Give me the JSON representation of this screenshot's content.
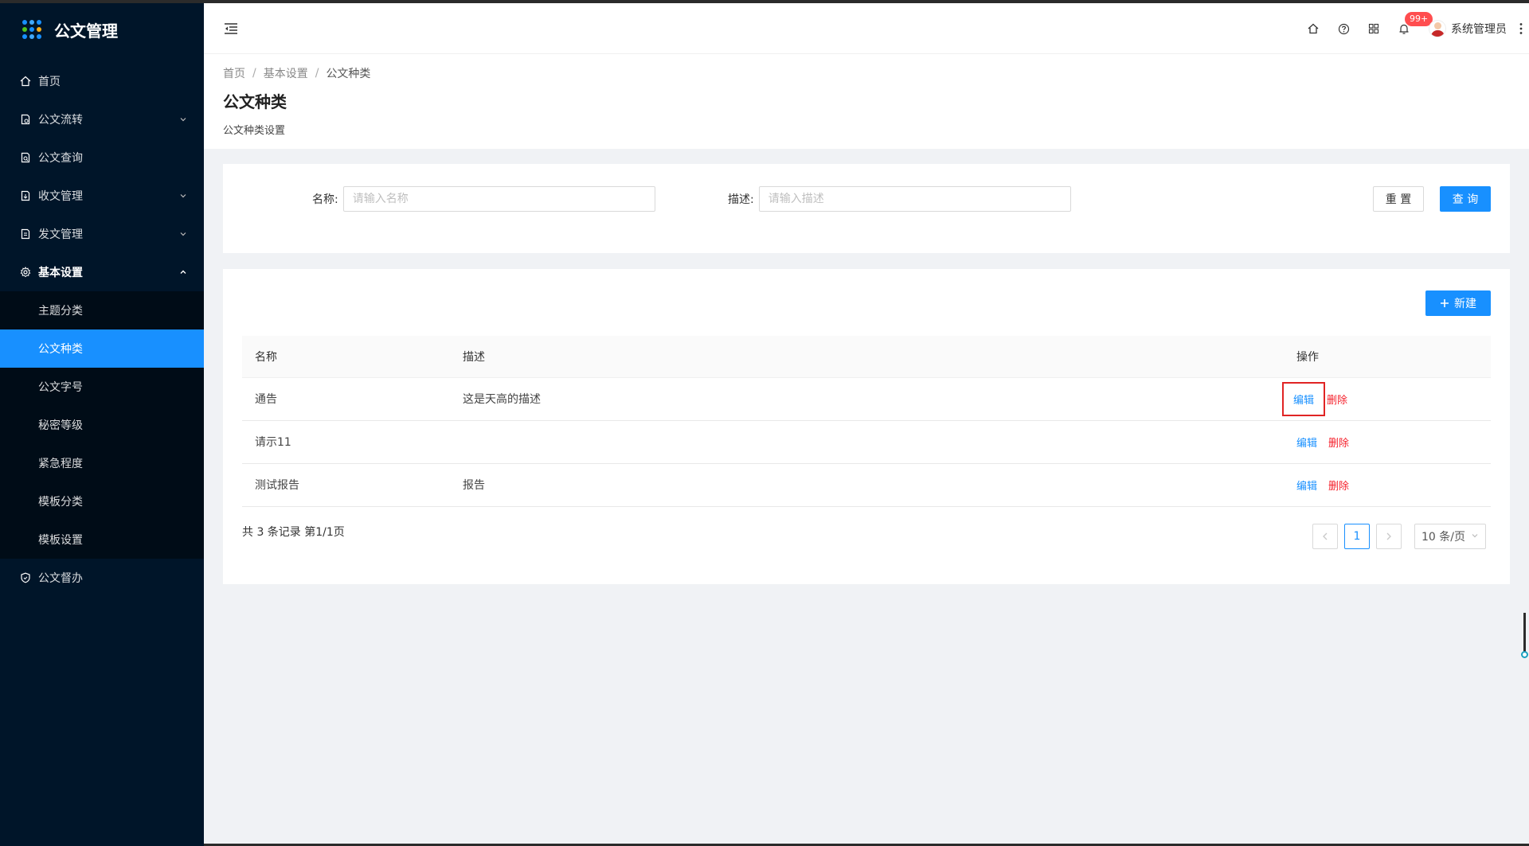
{
  "app": {
    "title": "公文管理"
  },
  "sidebar": {
    "items": [
      {
        "label": "首页",
        "icon": "home-icon"
      },
      {
        "label": "公文流转",
        "icon": "file-flow-icon",
        "expandable": true
      },
      {
        "label": "公文查询",
        "icon": "file-search-icon"
      },
      {
        "label": "收文管理",
        "icon": "file-receive-icon",
        "expandable": true
      },
      {
        "label": "发文管理",
        "icon": "file-send-icon",
        "expandable": true
      },
      {
        "label": "基本设置",
        "icon": "gear-icon",
        "expandable": true,
        "open": true
      },
      {
        "label": "公文督办",
        "icon": "shield-icon"
      }
    ],
    "sub_items": [
      {
        "label": "主题分类"
      },
      {
        "label": "公文种类",
        "active": true
      },
      {
        "label": "公文字号"
      },
      {
        "label": "秘密等级"
      },
      {
        "label": "紧急程度"
      },
      {
        "label": "模板分类"
      },
      {
        "label": "模板设置"
      }
    ]
  },
  "header": {
    "notification_badge": "99+",
    "user_name": "系统管理员"
  },
  "page": {
    "breadcrumb": [
      "首页",
      "基本设置",
      "公文种类"
    ],
    "breadcrumb_sep": "/",
    "title": "公文种类",
    "description": "公文种类设置"
  },
  "search": {
    "name_label": "名称:",
    "name_placeholder": "请输入名称",
    "name_value": "",
    "desc_label": "描述:",
    "desc_placeholder": "请输入描述",
    "desc_value": "",
    "reset_label": "重 置",
    "query_label": "查 询"
  },
  "toolbar": {
    "new_label": "新建"
  },
  "table": {
    "columns": [
      "名称",
      "描述",
      "操作"
    ],
    "rows": [
      {
        "name": "通告",
        "desc": "这是天高的描述",
        "edit": "编辑",
        "delete": "删除",
        "highlighted": true
      },
      {
        "name": "请示11",
        "desc": "",
        "edit": "编辑",
        "delete": "删除"
      },
      {
        "name": "测试报告",
        "desc": "报告",
        "edit": "编辑",
        "delete": "删除"
      }
    ]
  },
  "pagination": {
    "summary": "共 3 条记录 第1/1页",
    "current_page": "1",
    "page_size": "10 条/页"
  },
  "colors": {
    "primary": "#1890ff",
    "danger": "#f5222d",
    "sidebar_bg": "#001529",
    "highlight_box": "#e02424"
  }
}
